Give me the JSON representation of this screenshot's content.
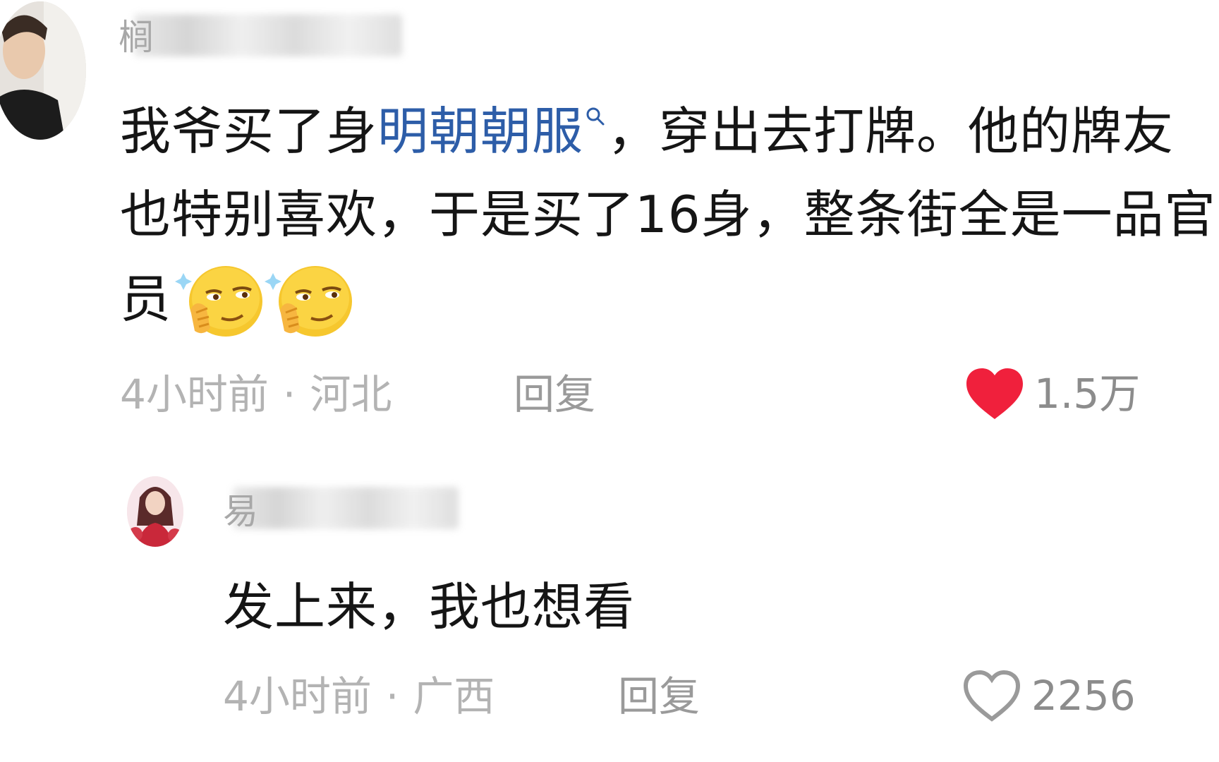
{
  "colors": {
    "text": "#151515",
    "keyword_link": "#2d5da8",
    "meta": "#b3b3b3",
    "like_active": "#f0203c",
    "like_inactive": "#9a9a9a"
  },
  "comments": [
    {
      "username_visible": "榈",
      "avatar_icon": "user-photo-avatar",
      "text_line1_before": "我爷买了身",
      "keyword": "明朝朝服",
      "text_line1_after": "，穿出去打牌。他的牌友",
      "text_line2": "也特别喜欢，于是买了16身，整条街全是一品官",
      "text_line3": "员",
      "emojis": [
        "smirk-emoji",
        "smirk-emoji"
      ],
      "time": "4小时前",
      "location": "河北",
      "separator": "·",
      "reply_label": "回复",
      "likes": "1.5万",
      "liked": true
    },
    {
      "username_visible": "易",
      "avatar_icon": "girl-avatar",
      "text": "发上来，我也想看",
      "time": "4小时前",
      "location": "广西",
      "separator": "·",
      "reply_label": "回复",
      "likes": "2256",
      "liked": false
    }
  ]
}
